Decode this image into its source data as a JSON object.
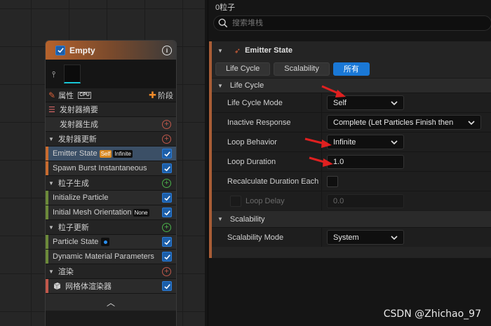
{
  "node": {
    "title": "Empty",
    "props_label": "属性",
    "props_badge": "CPU",
    "stage_label": "阶段",
    "rows": [
      {
        "type": "section",
        "label": "发射器摘要",
        "icon": "list-icon"
      },
      {
        "type": "sub",
        "label": "发射器生成",
        "plus": "red"
      },
      {
        "type": "section",
        "label": "发射器更新",
        "plus": "red"
      },
      {
        "type": "item",
        "label": "Emitter State",
        "badges": [
          "Self",
          "Infinite"
        ],
        "checked": true,
        "selected": true,
        "bar": "#c86b2f"
      },
      {
        "type": "item",
        "label": "Spawn Burst Instantaneous",
        "checked": true,
        "bar": "#c86b2f"
      },
      {
        "type": "section",
        "label": "粒子生成",
        "plus": "green"
      },
      {
        "type": "item",
        "label": "Initialize Particle",
        "checked": true,
        "bar": "#6c8a3a"
      },
      {
        "type": "item",
        "label": "Initial Mesh Orientation",
        "badges": [
          "None"
        ],
        "checked": true,
        "bar": "#6c8a3a"
      },
      {
        "type": "section",
        "label": "粒子更新",
        "plus": "green"
      },
      {
        "type": "item",
        "label": "Particle State",
        "badges": [
          "dot"
        ],
        "checked": true,
        "bar": "#6c8a3a"
      },
      {
        "type": "item",
        "label": "Dynamic Material Parameters",
        "checked": true,
        "bar": "#6c8a3a"
      },
      {
        "type": "section",
        "label": "渲染",
        "plus": "red"
      },
      {
        "type": "item",
        "label": "网格体渲染器",
        "checked": true,
        "bar": "#c1584b",
        "icon": "mesh-icon"
      }
    ]
  },
  "details": {
    "title": "0粒子",
    "search_placeholder": "搜索堆栈",
    "block_title": "Emitter State",
    "tabs": [
      {
        "label": "Life Cycle",
        "active": false
      },
      {
        "label": "Scalability",
        "active": false
      },
      {
        "label": "所有",
        "active": true
      }
    ],
    "life_cycle_cat": "Life Cycle",
    "props": {
      "life_cycle_mode": {
        "label": "Life Cycle Mode",
        "value": "Self"
      },
      "inactive_response": {
        "label": "Inactive Response",
        "value": "Complete (Let Particles Finish then"
      },
      "loop_behavior": {
        "label": "Loop Behavior",
        "value": "Infinite"
      },
      "loop_duration": {
        "label": "Loop Duration",
        "value": "1.0"
      },
      "recalc": {
        "label": "Recalculate Duration Each"
      },
      "loop_delay": {
        "label": "Loop Delay",
        "value": "0.0"
      }
    },
    "scalability_cat": "Scalability",
    "scalability_mode": {
      "label": "Scalability Mode",
      "value": "System"
    }
  },
  "watermark": "CSDN @Zhichao_97",
  "colors": {
    "accent": "#1a78d6",
    "emitter_accent": "#a85d36",
    "annotation_arrow": "#e02020"
  }
}
